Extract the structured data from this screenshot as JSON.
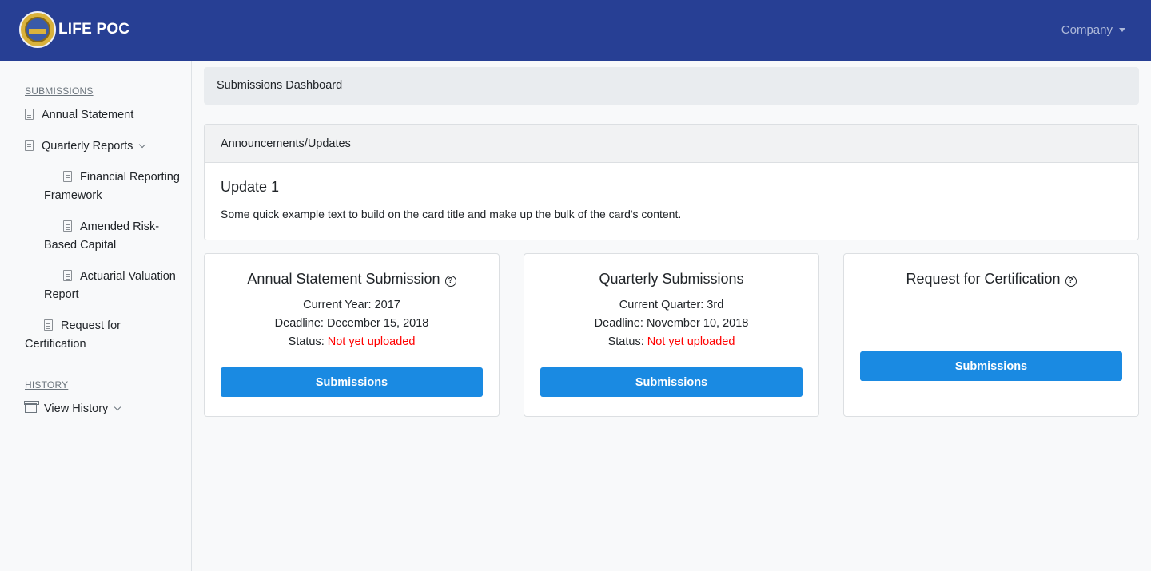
{
  "header": {
    "app_title": "LIFE POC",
    "company_menu": "Company",
    "bg_color": "#273f94"
  },
  "sidebar": {
    "submissions_heading": "SUBMISSIONS",
    "items": [
      {
        "label": "Annual Statement",
        "icon": "document-icon"
      },
      {
        "label": "Quarterly Reports",
        "icon": "document-icon",
        "expandable": true
      },
      {
        "label": "Financial Reporting Framework",
        "icon": "document-icon",
        "sub": true
      },
      {
        "label": "Amended Risk-Based Capital",
        "icon": "document-icon",
        "sub": true
      },
      {
        "label": "Actuarial Valuation Report",
        "icon": "document-icon",
        "sub": true
      },
      {
        "label": "Request for Certification",
        "icon": "document-icon"
      }
    ],
    "history_heading": "HISTORY",
    "history_item": {
      "label": "View History",
      "icon": "archive-icon",
      "expandable": true
    },
    "sub_labels": {
      "frf_1": "Financial Reporting",
      "frf_2": "Framework",
      "arbc_1": "Amended Risk-",
      "arbc_2": "Based Capital",
      "avr_1": "Actuarial Valuation",
      "avr_2": "Report",
      "rfc_1": "Request for",
      "rfc_2": "Certification"
    }
  },
  "breadcrumb": "Submissions Dashboard",
  "announcements": {
    "header": "Announcements/Updates",
    "title": "Update 1",
    "text": "Some quick example text to build on the card title and make up the bulk of the card's content."
  },
  "cards": [
    {
      "title": "Annual Statement Submission",
      "has_help": true,
      "line1": "Current Year: 2017",
      "line2": "Deadline: December 15, 2018",
      "status_label": "Status:",
      "status_value": "Not yet uploaded",
      "button": "Submissions"
    },
    {
      "title": "Quarterly Submissions",
      "has_help": false,
      "line1": "Current Quarter: 3rd",
      "line2": "Deadline: November 10, 2018",
      "status_label": "Status:",
      "status_value": "Not yet uploaded",
      "button": "Submissions"
    },
    {
      "title": "Request for Certification",
      "has_help": true,
      "button": "Submissions"
    }
  ],
  "colors": {
    "accent": "#1a8ae2",
    "status_error": "#ff0000"
  }
}
